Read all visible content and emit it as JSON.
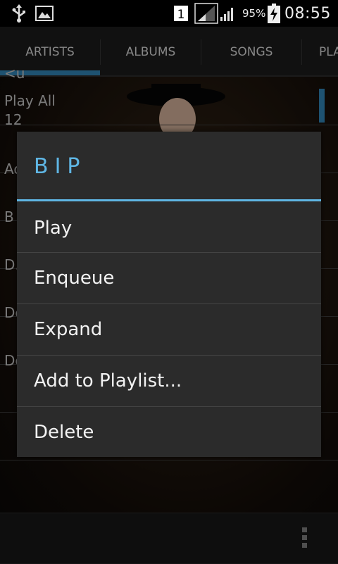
{
  "status_bar": {
    "icons": [
      "usb-icon",
      "image-icon",
      "sim-1-icon",
      "signal-icon",
      "signal-icon",
      "battery-charging-icon"
    ],
    "sim_slot": "1",
    "battery": "95%",
    "time": "08:55"
  },
  "tabs": [
    {
      "label": "ARTISTS",
      "selected": true
    },
    {
      "label": "ALBUMS",
      "selected": false
    },
    {
      "label": "SONGS",
      "selected": false
    },
    {
      "label": "PLA",
      "selected": false
    }
  ],
  "list": {
    "rows": [
      "Play All",
      "<u",
      "12",
      "Ac",
      "B",
      "D.",
      "De",
      "De"
    ]
  },
  "dialog": {
    "title": "BIP",
    "items": [
      "Play",
      "Enqueue",
      "Expand",
      "Add to Playlist...",
      "Delete"
    ]
  },
  "colors": {
    "accent": "#5fb6e4",
    "tab_indicator": "#2f7fae",
    "dialog_bg": "#2b2b2b"
  }
}
